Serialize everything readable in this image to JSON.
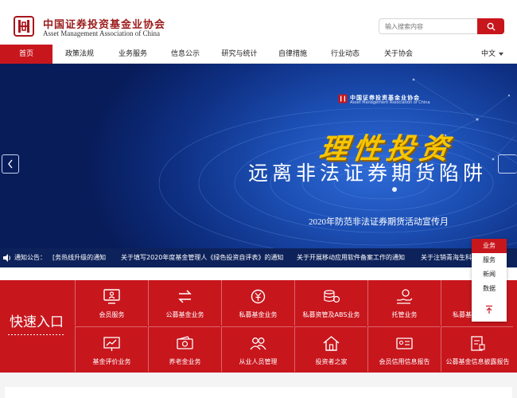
{
  "header": {
    "logo_cn": "中国证券投资基金业协会",
    "logo_en": "Asset Management Association of China",
    "search_placeholder": "输入搜索内容"
  },
  "nav": {
    "items": [
      "首页",
      "政策法规",
      "业务服务",
      "信息公示",
      "研究与统计",
      "自律措施",
      "行业动态",
      "关于协会"
    ],
    "language": "中文"
  },
  "banner": {
    "assoc_cn": "中国证券投资基金业协会",
    "assoc_en": "Asset Management Association of China",
    "slogan_main": "理性投资",
    "slogan_sub": "远离非法证券期货陷阱",
    "caption": "2020年防范非法证券期货活动宣传月"
  },
  "notice": {
    "label": "通知公告：",
    "items": [
      "[务热线升级的通知",
      "关于填写2020年度基金管理人《绿色投资自评表》的通知",
      "关于开展移动应用软件备案工作的通知",
      "关于注销青海生科"
    ]
  },
  "float_menu": {
    "items": [
      "业务",
      "服务",
      "新闻",
      "数据"
    ]
  },
  "quick": {
    "title": "快速入口",
    "row1": [
      "会员服务",
      "公募基金业务",
      "私募基金业务",
      "私募资管及ABS业务",
      "托管业务",
      "私募基"
    ],
    "row2": [
      "基金评价业务",
      "养老金业务",
      "从业人员管理",
      "投资者之家",
      "会员信用信息报告",
      "公募基金信息披露报告"
    ]
  },
  "colors": {
    "brand_red": "#c8161d",
    "banner_blue": "#1c4fb4",
    "notice_navy": "#0d225a",
    "slogan_gold": "#f7c500"
  }
}
